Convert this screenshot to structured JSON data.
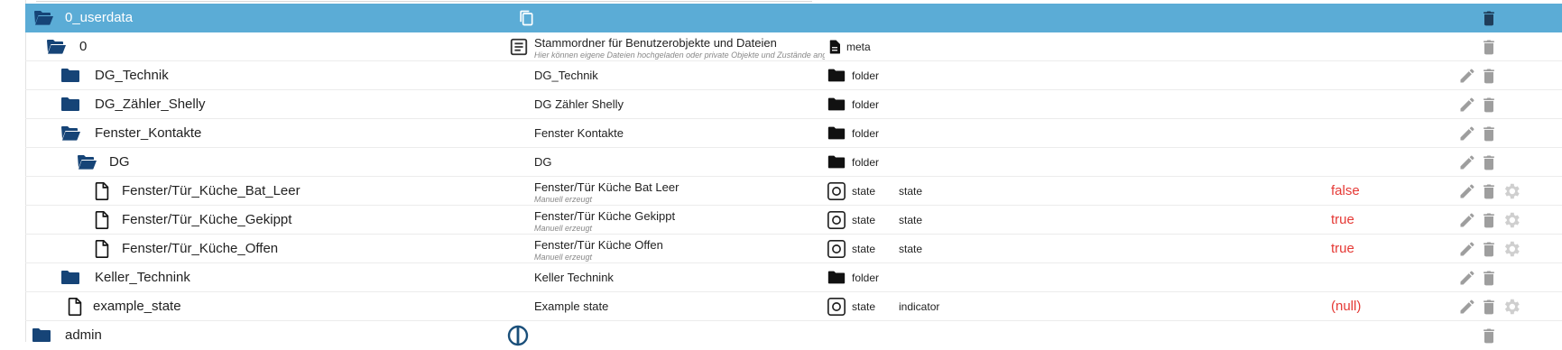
{
  "tree": {
    "rows": [
      {
        "name": "0_userdata"
      },
      {
        "name": "0",
        "description": "Stammordner für Benutzerobjekte und Dateien",
        "note": "Hier können eigene Dateien hochgeladen oder private Objekte und Zustände angelegt werden",
        "type": "meta"
      },
      {
        "name": "DG_Technik",
        "description": "DG_Technik",
        "type": "folder"
      },
      {
        "name": "DG_Zähler_Shelly",
        "description": "DG Zähler Shelly",
        "type": "folder"
      },
      {
        "name": "Fenster_Kontakte",
        "description": "Fenster Kontakte",
        "type": "folder"
      },
      {
        "name": "DG",
        "description": "DG",
        "type": "folder"
      },
      {
        "name": "Fenster/Tür_Küche_Bat_Leer",
        "description": "Fenster/Tür Küche Bat Leer",
        "note": "Manuell erzeugt",
        "type": "state",
        "role": "state",
        "value": "false"
      },
      {
        "name": "Fenster/Tür_Küche_Gekippt",
        "description": "Fenster/Tür Küche Gekippt",
        "note": "Manuell erzeugt",
        "type": "state",
        "role": "state",
        "value": "true"
      },
      {
        "name": "Fenster/Tür_Küche_Offen",
        "description": "Fenster/Tür Küche Offen",
        "note": "Manuell erzeugt",
        "type": "state",
        "role": "state",
        "value": "true"
      },
      {
        "name": "Keller_Technink",
        "description": "Keller Technink",
        "type": "folder"
      },
      {
        "name": "example_state",
        "description": "Example state",
        "type": "state",
        "role": "indicator",
        "value": "(null)"
      },
      {
        "name": "admin"
      }
    ]
  },
  "icons": {
    "folder_open": "folder-open-icon",
    "folder_closed": "folder-icon",
    "file": "file-icon",
    "copy": "copy-icon",
    "meta": "meta-document-icon",
    "state": "state-icon",
    "edit": "pencil-icon",
    "delete": "trash-icon",
    "settings": "gear-icon",
    "admin_logo": "iobroker-admin-icon"
  },
  "colors": {
    "selected_row": "#5bacd6",
    "folder": "#164477",
    "value": "#e53935",
    "action": "#9e9e9e"
  }
}
